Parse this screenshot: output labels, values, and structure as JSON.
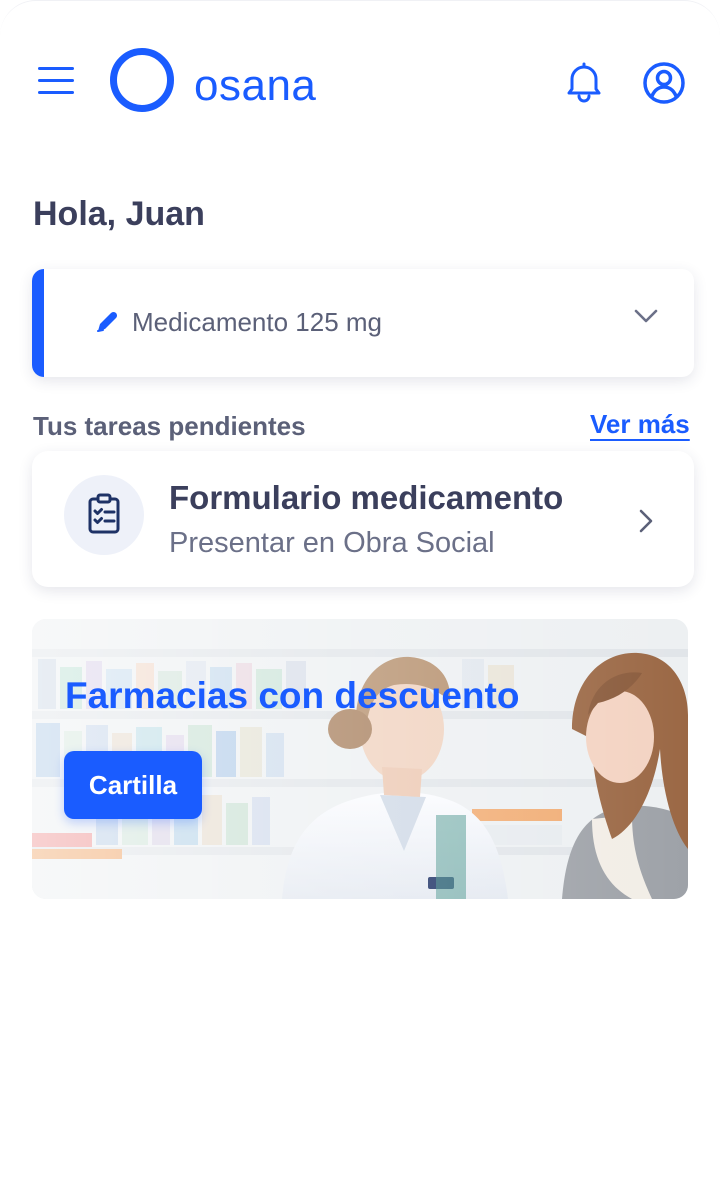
{
  "app": {
    "brand": "osana",
    "brand_color": "#1a5cff"
  },
  "header": {
    "menu_icon": "hamburger-menu-icon",
    "notifications_icon": "bell-icon",
    "profile_icon": "user-circle-icon"
  },
  "greeting": "Hola, Juan",
  "medication": {
    "icon": "pencil-icon",
    "label": "Medicamento 125 mg",
    "expand_icon": "chevron-down-icon"
  },
  "tasks": {
    "title": "Tus tareas pendientes",
    "see_more": "Ver más",
    "items": [
      {
        "icon": "clipboard-list-icon",
        "title": "Formulario medicamento",
        "subtitle": "Presentar en Obra Social",
        "action_icon": "chevron-right-icon"
      }
    ]
  },
  "promo": {
    "title": "Farmacias con descuento",
    "button_label": "Cartilla",
    "image": "pharmacist-with-customer-photo"
  }
}
